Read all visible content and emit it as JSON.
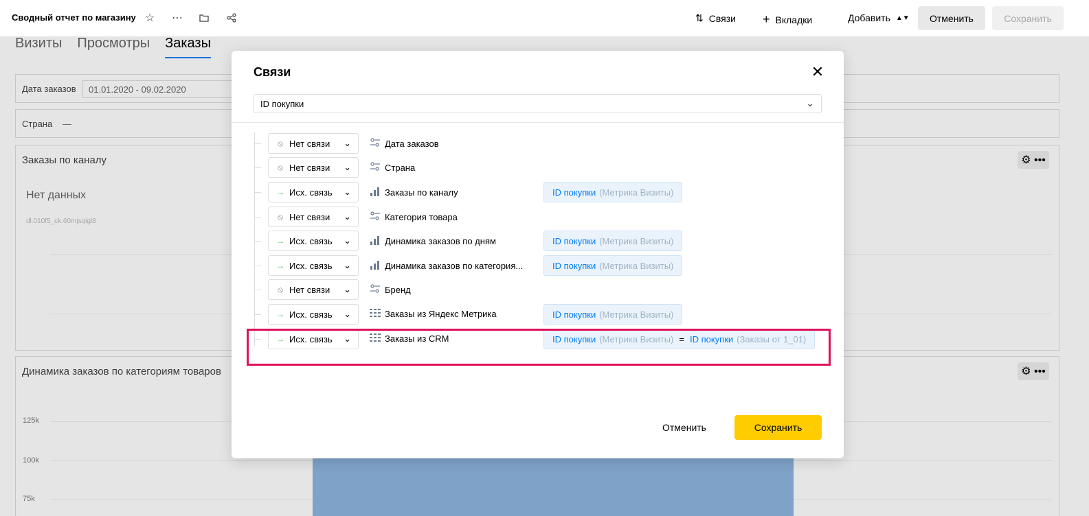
{
  "header": {
    "title": "Сводный отчет по магазину",
    "links_label": "Связи",
    "tabs_label": "Вкладки",
    "add_label": "Добавить",
    "cancel_label": "Отменить",
    "save_label": "Сохранить"
  },
  "tabs": [
    {
      "label": "Визиты"
    },
    {
      "label": "Просмотры"
    },
    {
      "label": "Заказы",
      "active": true
    }
  ],
  "filters": [
    {
      "label": "Дата заказов",
      "value": "01.01.2020 - 09.02.2020"
    },
    {
      "label": "Страна",
      "value": "—"
    }
  ],
  "widgets": [
    {
      "title": "Заказы по каналу",
      "empty_text": "Нет данных",
      "id_text": "dl.010f5_ck.60mjsqigl8"
    },
    {
      "title": "Динамика заказов по категориям товаров",
      "y_ticks": [
        "125k",
        "100k",
        "75k"
      ]
    }
  ],
  "modal": {
    "title": "Связи",
    "selector_value": "ID покупки",
    "rows": [
      {
        "status": "Нет связи",
        "type": "none",
        "widget": "Дата заказов",
        "widget_icon": "selector-icon",
        "chip": null
      },
      {
        "status": "Нет связи",
        "type": "none",
        "widget": "Страна",
        "widget_icon": "selector-icon",
        "chip": null
      },
      {
        "status": "Исх. связь",
        "type": "out",
        "widget": "Заказы по каналу",
        "widget_icon": "bar-chart-icon",
        "chip": {
          "field": "ID покупки",
          "source": "(Метрика Визиты)"
        }
      },
      {
        "status": "Нет связи",
        "type": "none",
        "widget": "Категория товара",
        "widget_icon": "selector-icon",
        "chip": null
      },
      {
        "status": "Исх. связь",
        "type": "out",
        "widget": "Динамика заказов по дням",
        "widget_icon": "bar-chart-icon",
        "chip": {
          "field": "ID покупки",
          "source": "(Метрика Визиты)"
        }
      },
      {
        "status": "Исх. связь",
        "type": "out",
        "widget": "Динамика заказов по категория...",
        "widget_icon": "bar-chart-icon",
        "chip": {
          "field": "ID покупки",
          "source": "(Метрика Визиты)"
        }
      },
      {
        "status": "Нет связи",
        "type": "none",
        "widget": "Бренд",
        "widget_icon": "selector-icon",
        "chip": null
      },
      {
        "status": "Исх. связь",
        "type": "out",
        "widget": "Заказы из Яндекс Метрика",
        "widget_icon": "table-icon",
        "chip": {
          "field": "ID покупки",
          "source": "(Метрика Визиты)"
        }
      },
      {
        "status": "Исх. связь",
        "type": "out",
        "widget": "Заказы из CRM",
        "widget_icon": "table-icon",
        "chip": {
          "field": "ID покупки",
          "source": "(Метрика Визиты)",
          "equals": "=",
          "field2": "ID покупки",
          "source2": "(Заказы от 1_01)"
        }
      }
    ],
    "cancel_label": "Отменить",
    "save_label": "Сохранить"
  }
}
